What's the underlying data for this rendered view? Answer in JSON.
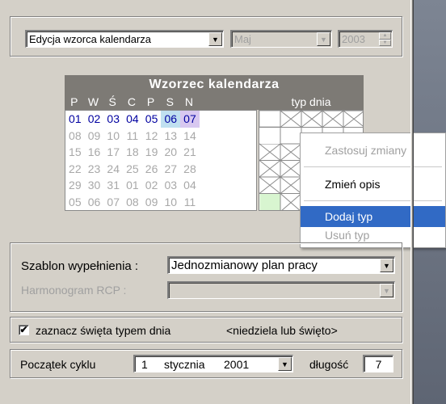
{
  "top_bar": {
    "mode_select": "Edycja wzorca kalendarza",
    "month_select": "Maj",
    "year_value": "2003"
  },
  "calendar": {
    "title": "Wzorzec kalendarza",
    "weekdays": [
      "P",
      "W",
      "Ś",
      "C",
      "P",
      "S",
      "N"
    ],
    "type_header": "typ dnia",
    "rows": [
      {
        "days": [
          "01",
          "02",
          "03",
          "04",
          "05",
          "06",
          "07"
        ],
        "state": "active"
      },
      {
        "days": [
          "08",
          "09",
          "10",
          "11",
          "12",
          "13",
          "14"
        ],
        "state": "inactive"
      },
      {
        "days": [
          "15",
          "16",
          "17",
          "18",
          "19",
          "20",
          "21"
        ],
        "state": "inactive"
      },
      {
        "days": [
          "22",
          "23",
          "24",
          "25",
          "26",
          "27",
          "28"
        ],
        "state": "inactive"
      },
      {
        "days": [
          "29",
          "30",
          "31",
          "01",
          "02",
          "03",
          "04"
        ],
        "state": "inactive"
      },
      {
        "days": [
          "05",
          "06",
          "07",
          "08",
          "09",
          "10",
          "11"
        ],
        "state": "inactive"
      }
    ]
  },
  "context_menu": {
    "items": [
      {
        "label": "Zastosuj zmiany",
        "state": "disabled"
      },
      {
        "label": "Zmień opis",
        "state": "enabled"
      },
      {
        "label": "Dodaj typ",
        "state": "highlighted"
      },
      {
        "label": "Usuń typ",
        "state": "disabled"
      }
    ]
  },
  "fill": {
    "template_label": "Szablon wypełnienia :",
    "template_value": "Jednozmianowy plan pracy",
    "rcp_label": "Harmonogram RCP :",
    "rcp_value": ""
  },
  "holidays": {
    "checked": true,
    "label": "zaznacz święta typem dnia",
    "hint": "<niedziela lub święto>"
  },
  "cycle": {
    "start_label": "Początek cyklu",
    "day": "1",
    "month": "stycznia",
    "year": "2001",
    "length_label": "długość",
    "length_value": "7"
  },
  "colors": {
    "header_bg": "#7d7a75",
    "highlight": "#316ac5",
    "active_day": "#0000a0"
  }
}
